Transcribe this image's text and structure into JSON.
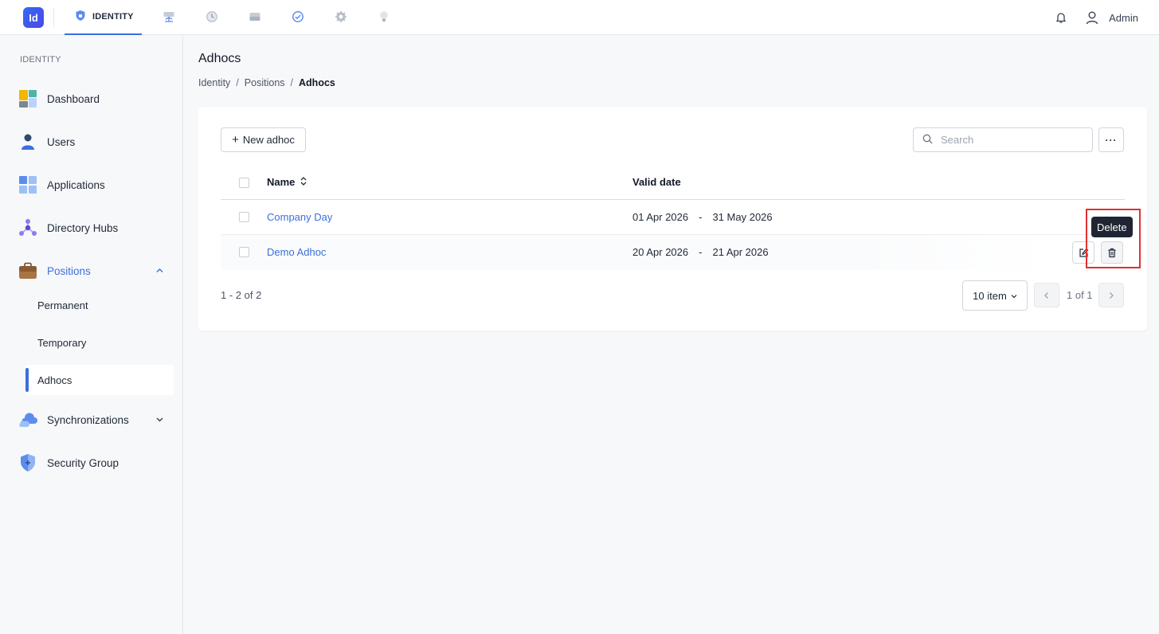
{
  "app": {
    "logo_text": "Id",
    "active_module": "IDENTITY",
    "user_name": "Admin"
  },
  "top_icons": [
    "monitor-icon",
    "history-icon",
    "server-icon",
    "check-circle-icon",
    "settings-icon",
    "lightbulb-icon"
  ],
  "sidebar": {
    "section": "IDENTITY",
    "items": [
      {
        "label": "Dashboard",
        "icon": "dashboard-icon"
      },
      {
        "label": "Users",
        "icon": "user-icon"
      },
      {
        "label": "Applications",
        "icon": "applications-icon"
      },
      {
        "label": "Directory Hubs",
        "icon": "directory-hub-icon"
      },
      {
        "label": "Positions",
        "icon": "briefcase-icon",
        "expanded": true
      },
      {
        "label": "Synchronizations",
        "icon": "cloud-sync-icon",
        "expanded": false
      },
      {
        "label": "Security Group",
        "icon": "shield-icon"
      }
    ],
    "positions_children": [
      "Permanent",
      "Temporary",
      "Adhocs"
    ],
    "active_child": "Adhocs"
  },
  "page": {
    "title": "Adhocs",
    "breadcrumb": [
      "Identity",
      "Positions",
      "Adhocs"
    ],
    "separator": "/"
  },
  "toolbar": {
    "new_label": "New adhoc",
    "search_placeholder": "Search",
    "more_label": "···"
  },
  "table": {
    "columns": [
      "Name",
      "Valid date"
    ],
    "rows": [
      {
        "name": "Company Day",
        "start": "01 Apr 2026",
        "end": "31 May 2026"
      },
      {
        "name": "Demo Adhoc",
        "start": "20 Apr 2026",
        "end": "21 Apr 2026"
      }
    ],
    "date_separator": "-"
  },
  "tooltip": "Delete",
  "pagination": {
    "summary": "1 - 2 of 2",
    "page_size": "10 item",
    "page_label": "1 of 1"
  },
  "colors": {
    "accent": "#3b6fe0",
    "highlight": "#e03131",
    "tooltip_bg": "#1f2533"
  }
}
